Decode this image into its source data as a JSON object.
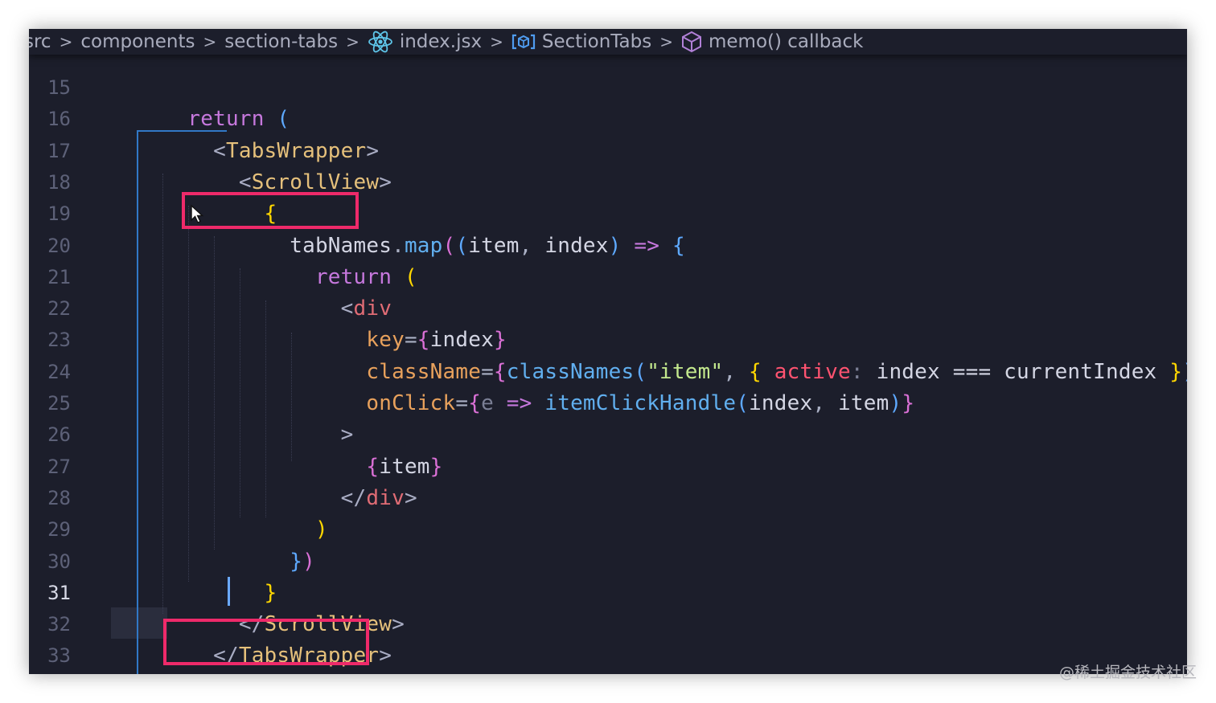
{
  "breadcrumb": {
    "items": [
      {
        "label": "src",
        "icon": ""
      },
      {
        "label": "components",
        "icon": ""
      },
      {
        "label": "section-tabs",
        "icon": ""
      },
      {
        "label": "index.jsx",
        "icon": "react-icon"
      },
      {
        "label": "SectionTabs",
        "icon": "symbol-variable-icon"
      },
      {
        "label": "memo() callback",
        "icon": "cube-icon"
      }
    ],
    "separator": ">"
  },
  "editor": {
    "active_line": "31",
    "lines": [
      {
        "number": "15",
        "tokens": []
      },
      {
        "number": "16",
        "tokens": [
          {
            "t": "    ",
            "c": ""
          },
          {
            "t": "return",
            "c": "kw"
          },
          {
            "t": " ",
            "c": ""
          },
          {
            "t": "(",
            "c": "br3"
          }
        ]
      },
      {
        "number": "17",
        "tokens": [
          {
            "t": "      ",
            "c": ""
          },
          {
            "t": "<",
            "c": "lt"
          },
          {
            "t": "TabsWrapper",
            "c": "tag"
          },
          {
            "t": ">",
            "c": "lt"
          }
        ]
      },
      {
        "number": "18",
        "tokens": [
          {
            "t": "        ",
            "c": ""
          },
          {
            "t": "<",
            "c": "lt"
          },
          {
            "t": "ScrollView",
            "c": "tag"
          },
          {
            "t": ">",
            "c": "lt"
          }
        ]
      },
      {
        "number": "19",
        "tokens": [
          {
            "t": "          ",
            "c": ""
          },
          {
            "t": "{",
            "c": "br1"
          }
        ]
      },
      {
        "number": "20",
        "tokens": [
          {
            "t": "            ",
            "c": ""
          },
          {
            "t": "tabNames",
            "c": "prm"
          },
          {
            "t": ".",
            "c": "pun"
          },
          {
            "t": "map",
            "c": "fn"
          },
          {
            "t": "(",
            "c": "br2"
          },
          {
            "t": "(",
            "c": "br3"
          },
          {
            "t": "item",
            "c": "prm"
          },
          {
            "t": ", ",
            "c": "pun"
          },
          {
            "t": "index",
            "c": "prm"
          },
          {
            "t": ")",
            "c": "br3"
          },
          {
            "t": " ",
            "c": ""
          },
          {
            "t": "=>",
            "c": "kw"
          },
          {
            "t": " ",
            "c": ""
          },
          {
            "t": "{",
            "c": "br3"
          }
        ]
      },
      {
        "number": "21",
        "tokens": [
          {
            "t": "              ",
            "c": ""
          },
          {
            "t": "return",
            "c": "kw"
          },
          {
            "t": " ",
            "c": ""
          },
          {
            "t": "(",
            "c": "br1"
          }
        ]
      },
      {
        "number": "22",
        "tokens": [
          {
            "t": "                ",
            "c": ""
          },
          {
            "t": "<",
            "c": "lt"
          },
          {
            "t": "div",
            "c": "tag2"
          }
        ]
      },
      {
        "number": "23",
        "tokens": [
          {
            "t": "                  ",
            "c": ""
          },
          {
            "t": "key",
            "c": "attr"
          },
          {
            "t": "=",
            "c": "pun"
          },
          {
            "t": "{",
            "c": "br2"
          },
          {
            "t": "index",
            "c": "prm"
          },
          {
            "t": "}",
            "c": "br2"
          }
        ]
      },
      {
        "number": "24",
        "tokens": [
          {
            "t": "                  ",
            "c": ""
          },
          {
            "t": "className",
            "c": "attr"
          },
          {
            "t": "=",
            "c": "pun"
          },
          {
            "t": "{",
            "c": "br2"
          },
          {
            "t": "classNames",
            "c": "fn"
          },
          {
            "t": "(",
            "c": "br3"
          },
          {
            "t": "\"item\"",
            "c": "str"
          },
          {
            "t": ", ",
            "c": "pun"
          },
          {
            "t": "{",
            "c": "br1"
          },
          {
            "t": " ",
            "c": ""
          },
          {
            "t": "active",
            "c": "red"
          },
          {
            "t": ": ",
            "c": "gray"
          },
          {
            "t": "index",
            "c": "prm"
          },
          {
            "t": " ",
            "c": ""
          },
          {
            "t": "===",
            "c": "prm"
          },
          {
            "t": " ",
            "c": ""
          },
          {
            "t": "currentIndex",
            "c": "prm"
          },
          {
            "t": " ",
            "c": ""
          },
          {
            "t": "}",
            "c": "br1"
          },
          {
            "t": ")",
            "c": "br3"
          },
          {
            "t": "}",
            "c": "br2"
          }
        ]
      },
      {
        "number": "25",
        "tokens": [
          {
            "t": "                  ",
            "c": ""
          },
          {
            "t": "onClick",
            "c": "attr"
          },
          {
            "t": "=",
            "c": "pun"
          },
          {
            "t": "{",
            "c": "br2"
          },
          {
            "t": "e",
            "c": "gray"
          },
          {
            "t": " ",
            "c": ""
          },
          {
            "t": "=>",
            "c": "kw"
          },
          {
            "t": " ",
            "c": ""
          },
          {
            "t": "itemClickHandle",
            "c": "fn"
          },
          {
            "t": "(",
            "c": "br3"
          },
          {
            "t": "index",
            "c": "prm"
          },
          {
            "t": ", ",
            "c": "pun"
          },
          {
            "t": "item",
            "c": "prm"
          },
          {
            "t": ")",
            "c": "br3"
          },
          {
            "t": "}",
            "c": "br2"
          }
        ]
      },
      {
        "number": "26",
        "tokens": [
          {
            "t": "                ",
            "c": ""
          },
          {
            "t": ">",
            "c": "lt"
          }
        ]
      },
      {
        "number": "27",
        "tokens": [
          {
            "t": "                  ",
            "c": ""
          },
          {
            "t": "{",
            "c": "br2"
          },
          {
            "t": "item",
            "c": "prm"
          },
          {
            "t": "}",
            "c": "br2"
          }
        ]
      },
      {
        "number": "28",
        "tokens": [
          {
            "t": "                ",
            "c": ""
          },
          {
            "t": "</",
            "c": "lt"
          },
          {
            "t": "div",
            "c": "tag2"
          },
          {
            "t": ">",
            "c": "lt"
          }
        ]
      },
      {
        "number": "29",
        "tokens": [
          {
            "t": "              ",
            "c": ""
          },
          {
            "t": ")",
            "c": "br1"
          }
        ]
      },
      {
        "number": "30",
        "tokens": [
          {
            "t": "            ",
            "c": ""
          },
          {
            "t": "}",
            "c": "br3"
          },
          {
            "t": ")",
            "c": "br2"
          }
        ]
      },
      {
        "number": "31",
        "tokens": [
          {
            "t": "          ",
            "c": ""
          },
          {
            "t": "}",
            "c": "br1"
          }
        ]
      },
      {
        "number": "32",
        "tokens": [
          {
            "t": "        ",
            "c": ""
          },
          {
            "t": "</",
            "c": "lt"
          },
          {
            "t": "ScrollView",
            "c": "tag"
          },
          {
            "t": ">",
            "c": "lt"
          }
        ]
      },
      {
        "number": "33",
        "tokens": [
          {
            "t": "      ",
            "c": ""
          },
          {
            "t": "</",
            "c": "lt"
          },
          {
            "t": "TabsWrapper",
            "c": "tag"
          },
          {
            "t": ">",
            "c": "lt"
          }
        ]
      }
    ]
  },
  "highlight_color": "#ee2a6a",
  "watermark": "@稀土掘金技术社区"
}
